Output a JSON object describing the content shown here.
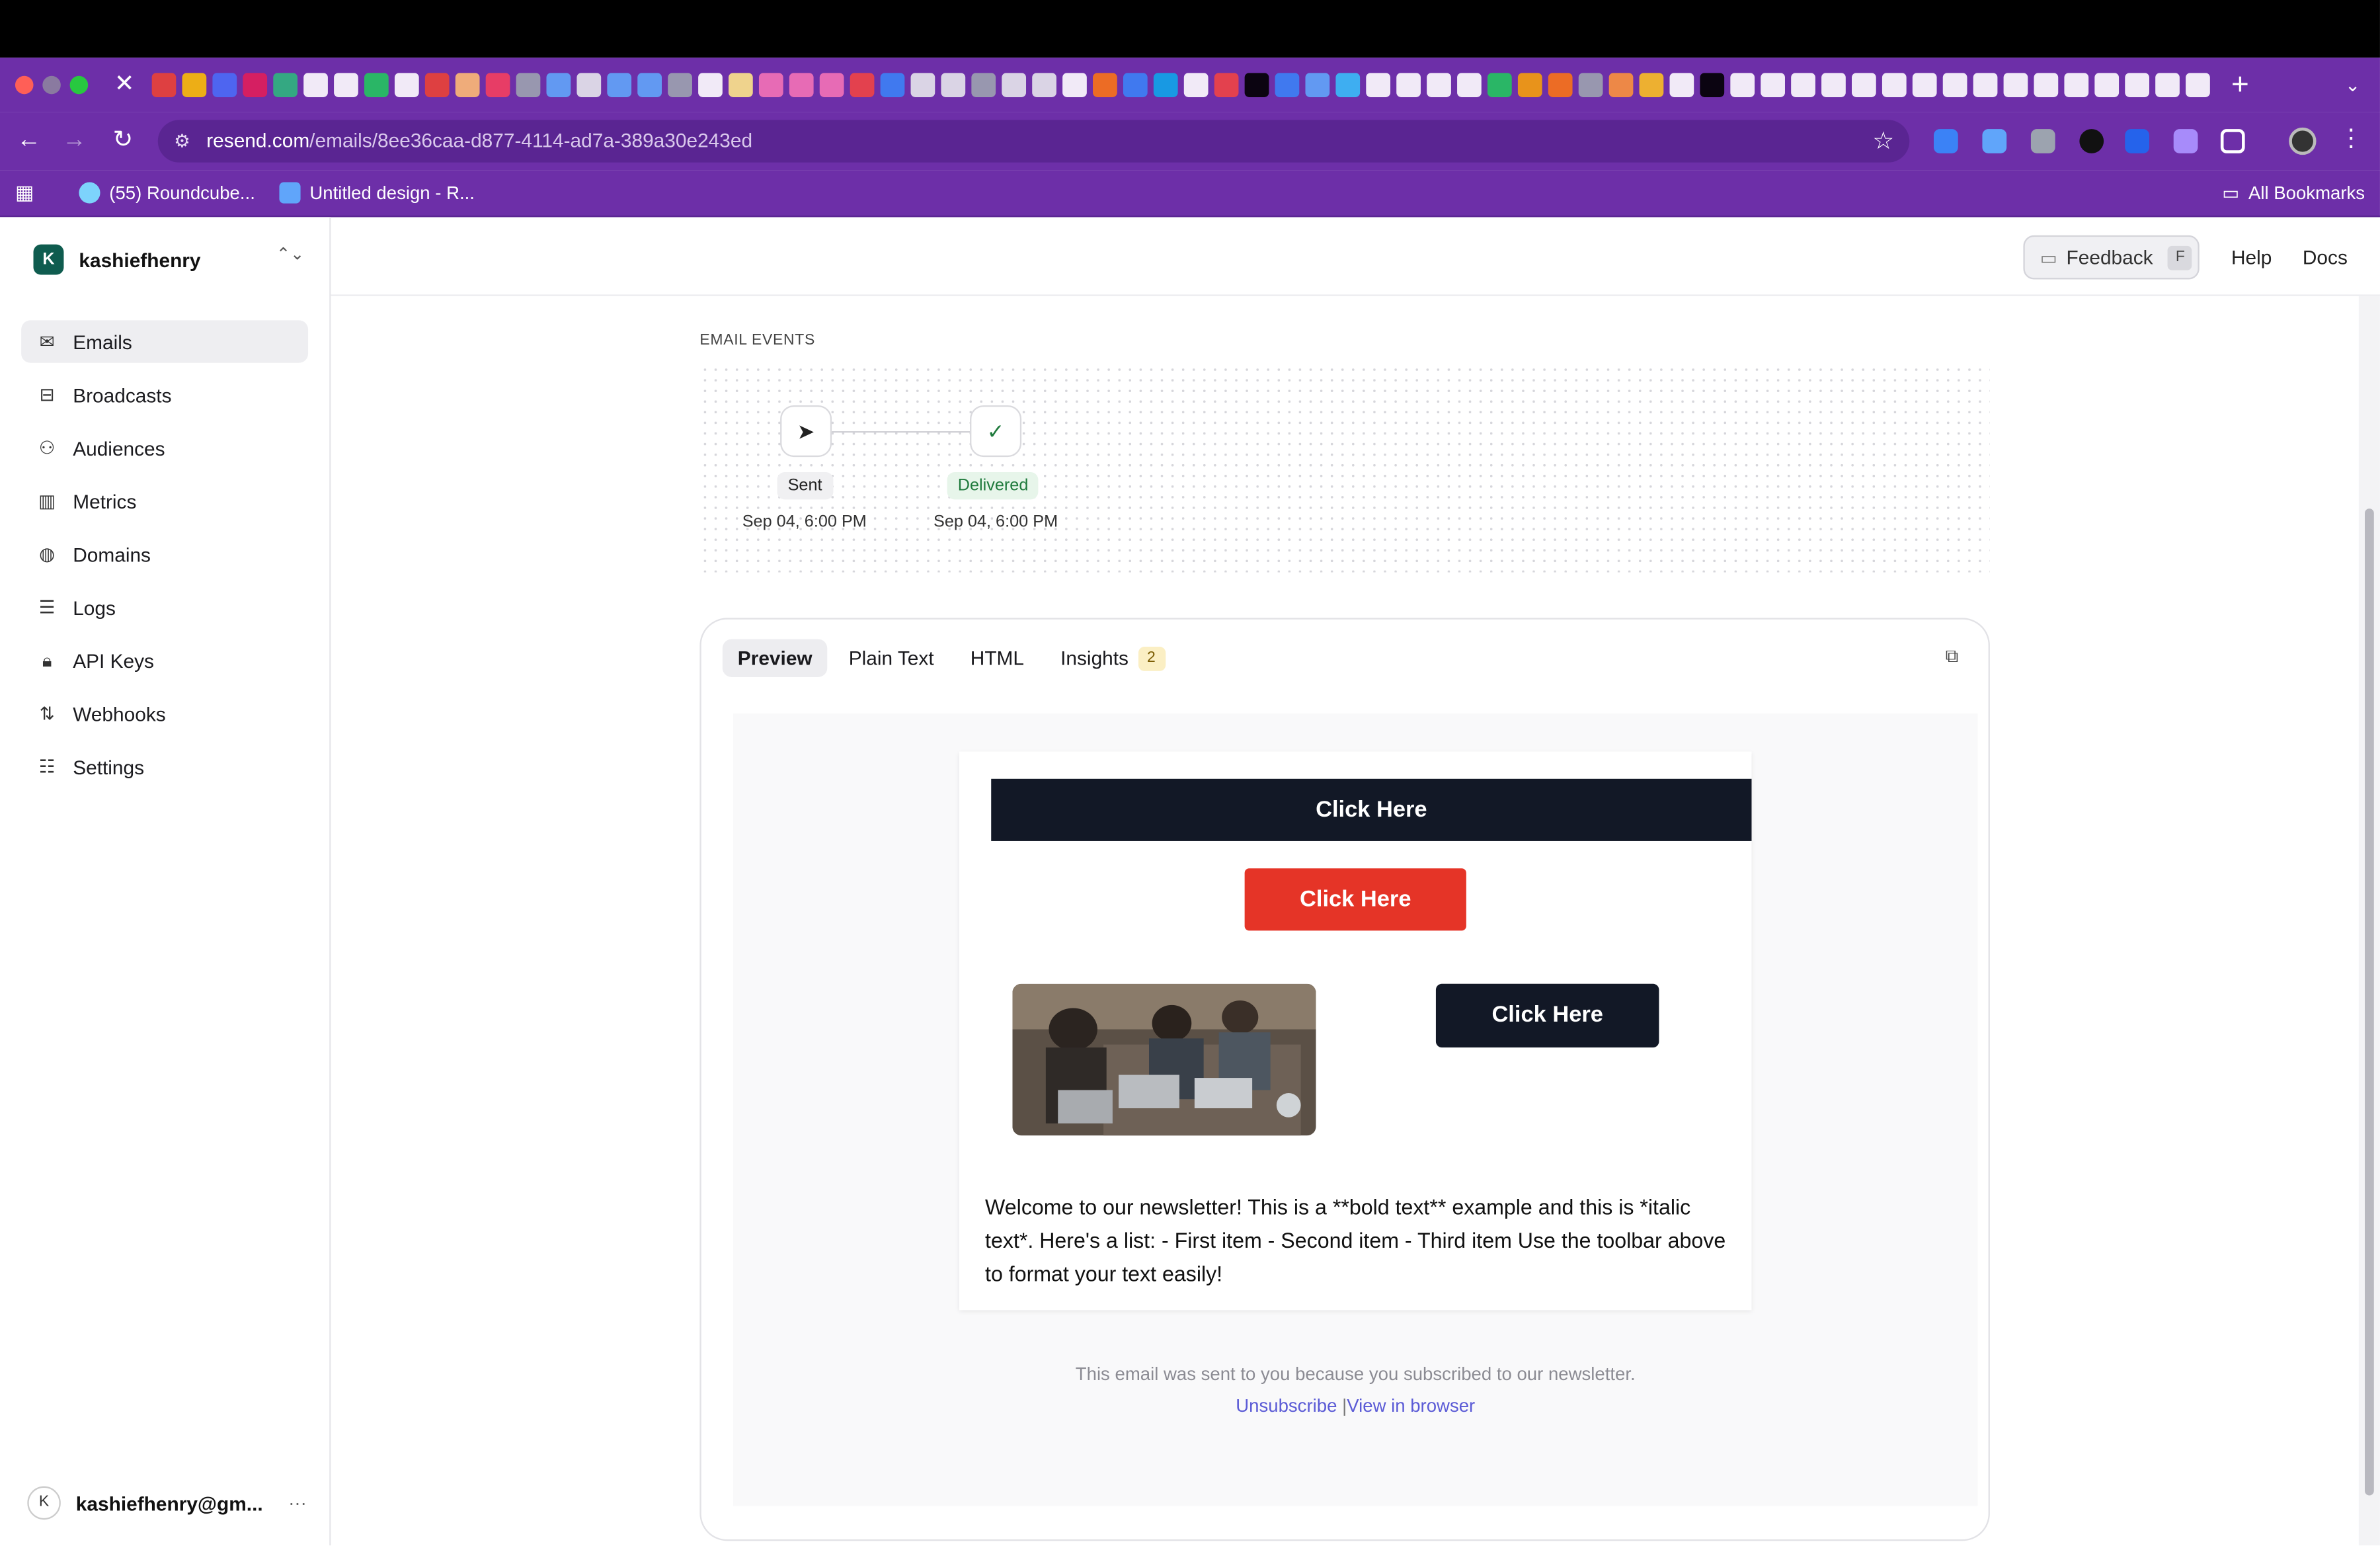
{
  "browser": {
    "url_domain": "resend.com",
    "url_path": "/emails/8ee36caa-d877-4114-ad7a-389a30e243ed",
    "bookmarks": [
      "(55) Roundcube...",
      "Untitled design - R..."
    ],
    "all_bookmarks": "All Bookmarks"
  },
  "sidebar": {
    "team_initial": "K",
    "team_name": "kashiefhenry",
    "items": [
      {
        "label": "Emails",
        "icon": "mail-icon"
      },
      {
        "label": "Broadcasts",
        "icon": "inbox-icon"
      },
      {
        "label": "Audiences",
        "icon": "users-icon"
      },
      {
        "label": "Metrics",
        "icon": "bar-chart-icon"
      },
      {
        "label": "Domains",
        "icon": "globe-icon"
      },
      {
        "label": "Logs",
        "icon": "logs-icon"
      },
      {
        "label": "API Keys",
        "icon": "lock-icon"
      },
      {
        "label": "Webhooks",
        "icon": "webhook-icon"
      },
      {
        "label": "Settings",
        "icon": "sliders-icon"
      }
    ],
    "user_initial": "K",
    "user_email": "kashiefhenry@gm...",
    "user_more": "···"
  },
  "topbar": {
    "feedback_label": "Feedback",
    "feedback_key": "F",
    "help_label": "Help",
    "docs_label": "Docs"
  },
  "events": {
    "title": "EMAIL EVENTS",
    "sent": {
      "label": "Sent",
      "time": "Sep 04, 6:00 PM"
    },
    "delivered": {
      "label": "Delivered",
      "time": "Sep 04, 6:00 PM"
    }
  },
  "preview": {
    "tabs": [
      {
        "label": "Preview"
      },
      {
        "label": "Plain Text"
      },
      {
        "label": "HTML"
      },
      {
        "label": "Insights",
        "count": "2"
      }
    ],
    "email": {
      "button1": "Click Here",
      "button2": "Click Here",
      "button3": "Click Here",
      "body_text": "Welcome to our newsletter! This is a **bold text** example and this is *italic text*. Here's a list: - First item - Second item - Third item Use the toolbar above to format your text easily!"
    },
    "footer_note": "This email was sent to you because you subscribed to our newsletter.",
    "unsubscribe": "Unsubscribe",
    "separator": "|",
    "view_in_browser": "View in browser"
  },
  "colors": {
    "browser_frame": "#6d2fa8",
    "dark_button": "#121826",
    "red_button": "#e53427",
    "delivered_green": "#1f7a3c",
    "link_blue": "#5b5bd6"
  }
}
